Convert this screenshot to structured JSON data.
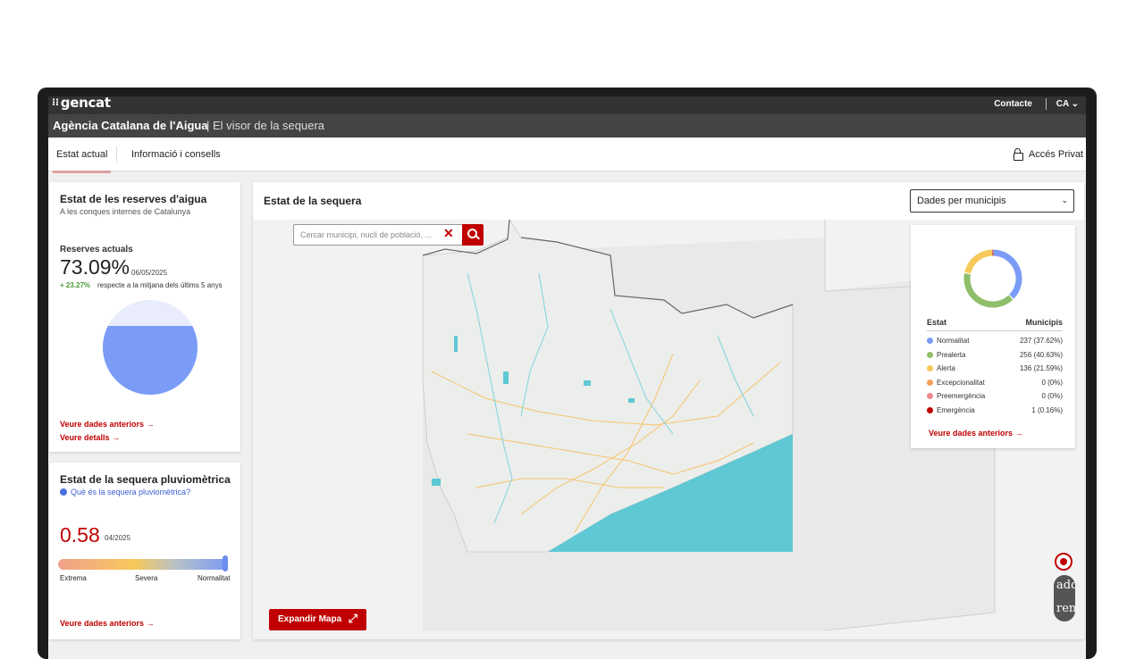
{
  "header": {
    "logo": "gencat",
    "contact": "Contacte",
    "lang": "CA",
    "agency": "Agència Catalana de l'Aigua",
    "separator": "|",
    "app_title": "El visor de la sequera"
  },
  "nav": {
    "tabs": [
      {
        "label": "Estat actual"
      },
      {
        "label": "Informació i consells"
      }
    ],
    "private_access": "Accés Privat"
  },
  "reserves": {
    "title": "Estat de les reserves d'aigua",
    "subtitle": "A les conques internes de Catalunya",
    "current_label": "Reserves actuals",
    "percent": "73.09%",
    "fill_fraction": 0.7309,
    "date": "06/05/2025",
    "change": "+ 23.27%",
    "change_desc": "respecte a la mitjana dels últims 5 anys",
    "link_previous": "Veure dades anteriors",
    "link_details": "Veure detalls"
  },
  "rain": {
    "title": "Estat de la sequera pluviomètrica",
    "info_link": "Què és la sequera pluviomètrica?",
    "value": "0.58",
    "date": "04/2025",
    "scale_position": 1.0,
    "scale_labels": {
      "low": "Extrema",
      "mid": "Severa",
      "high": "Normalitat"
    },
    "link_previous": "Veure dades anteriors"
  },
  "map": {
    "title": "Estat de la sequera",
    "select_value": "Dades per municipis",
    "search_placeholder": "Cercar municipi, nucli de població, ...",
    "expand_button": "Expandir Mapa",
    "zoom_in": "add",
    "zoom_out": "remove"
  },
  "legend": {
    "col_state": "Estat",
    "col_municipalities": "Municipis",
    "link_previous": "Veure dades anteriors",
    "rows": [
      {
        "name": "Normalitat",
        "value": "237 (37.62%)",
        "count": 237,
        "color": "#7b9cf6"
      },
      {
        "name": "Prealerta",
        "value": "256 (40.63%)",
        "count": 256,
        "color": "#8fbf6a"
      },
      {
        "name": "Alerta",
        "value": "136 (21.59%)",
        "count": 136,
        "color": "#f7c95a"
      },
      {
        "name": "Excepcionalitat",
        "value": "0 (0%)",
        "count": 0,
        "color": "#f5a05a"
      },
      {
        "name": "Preemergència",
        "value": "0 (0%)",
        "count": 0,
        "color": "#ee8a8a"
      },
      {
        "name": "Emergència",
        "value": "1 (0.16%)",
        "count": 1,
        "color": "#c00000"
      }
    ]
  },
  "colors": {
    "accent_red": "#c00000",
    "sea": "#5ec8d4",
    "change_positive": "#4a9a3a"
  }
}
